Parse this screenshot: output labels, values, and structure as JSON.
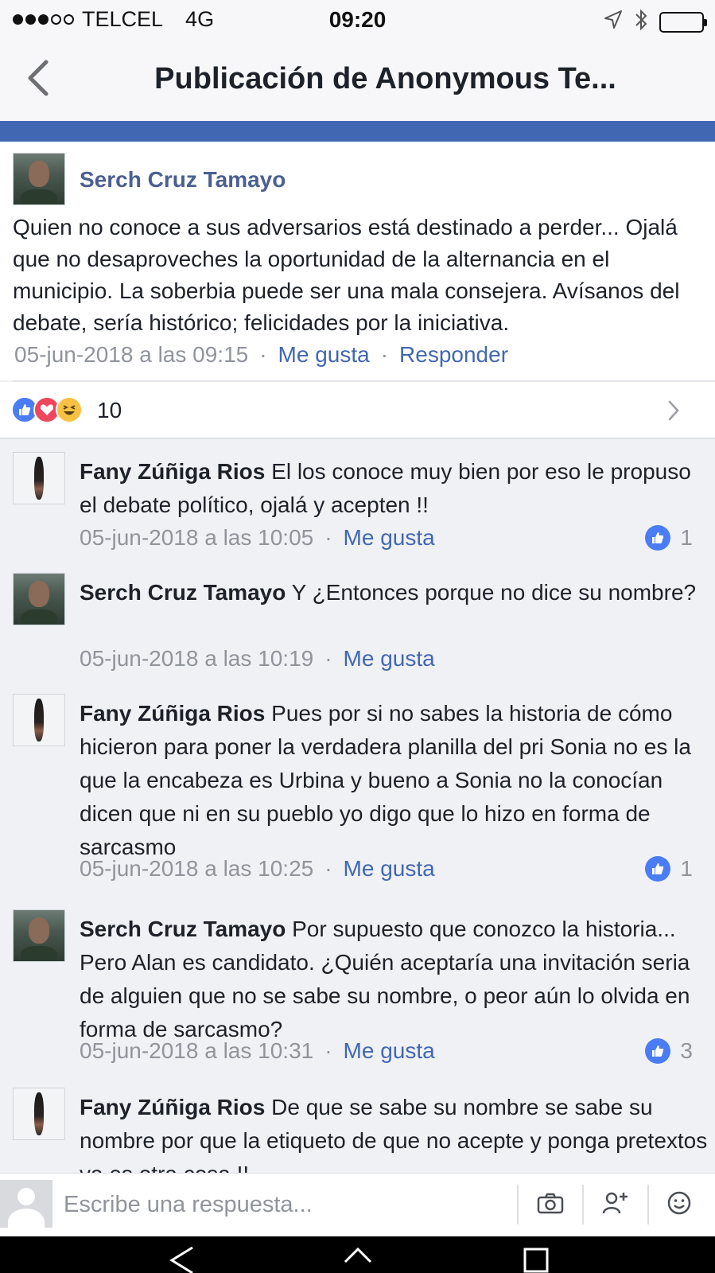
{
  "status_bar": {
    "carrier": "TELCEL",
    "network": "4G",
    "time": "09:20",
    "signal_bars_filled": 3,
    "signal_bars_total": 5,
    "icons": [
      "location-arrow-icon",
      "bluetooth-icon",
      "battery-icon"
    ]
  },
  "nav": {
    "title": "Publicación de Anonymous Te...",
    "back_icon": "chevron-left-icon"
  },
  "colors": {
    "brand_blue": "#4267b2",
    "name_blue": "#4b5f91",
    "meta_gray": "#90949c",
    "like_blue": "#4a7cf6"
  },
  "main_comment": {
    "author": "Serch Cruz Tamayo",
    "text": "Quien no conoce a sus adversarios está destinado a perder... Ojalá que no desaproveches la oportunidad de la alternancia en el municipio. La soberbia puede ser una mala consejera. Avísanos del debate, sería histórico; felicidades por la iniciativa.",
    "timestamp": "05-jun-2018 a las 09:15",
    "like_label": "Me gusta",
    "reply_label": "Responder",
    "separator": "·"
  },
  "reactions": {
    "types": [
      "like",
      "love",
      "haha"
    ],
    "count": "10",
    "chevron_icon": "chevron-right-icon"
  },
  "replies": [
    {
      "author": "Fany Zúñiga Rios",
      "text": "El los conoce muy bien por eso le propuso el debate político, ojalá y acepten !!",
      "timestamp": "05-jun-2018 a las 10:05",
      "like_label": "Me gusta",
      "likes": "1"
    },
    {
      "author": "Serch Cruz Tamayo",
      "text": "Y ¿Entonces porque no dice su nombre?",
      "timestamp": "05-jun-2018 a las 10:19",
      "like_label": "Me gusta",
      "likes": ""
    },
    {
      "author": "Fany Zúñiga Rios",
      "text": "Pues por si no sabes la historia de cómo hicieron para poner la verdadera planilla del pri Sonia no es la que la encabeza es Urbina y bueno a Sonia no la conocían dicen que ni en su pueblo yo digo que lo hizo en forma de sarcasmo",
      "timestamp": "05-jun-2018 a las 10:25",
      "like_label": "Me gusta",
      "likes": "1"
    },
    {
      "author": "Serch Cruz Tamayo",
      "text": "Por supuesto que conozco la historia... Pero Alan es candidato. ¿Quién aceptaría una invitación seria de alguien que no se sabe su nombre, o peor aún lo olvida en forma de sarcasmo?",
      "timestamp": "05-jun-2018 a las 10:31",
      "like_label": "Me gusta",
      "likes": "3"
    },
    {
      "author": "Fany Zúñiga Rios",
      "text": "De que se sabe su nombre se sabe su nombre por que la etiqueto de que no acepte y ponga pretextos ya es otra cosa !!",
      "timestamp": "",
      "like_label": "",
      "likes": ""
    }
  ],
  "composer": {
    "placeholder": "Escribe una respuesta...",
    "buttons": [
      "camera-icon",
      "add-person-icon",
      "emoji-icon"
    ]
  },
  "system_nav": [
    "back-triangle-icon",
    "home-icon",
    "recents-icon"
  ]
}
